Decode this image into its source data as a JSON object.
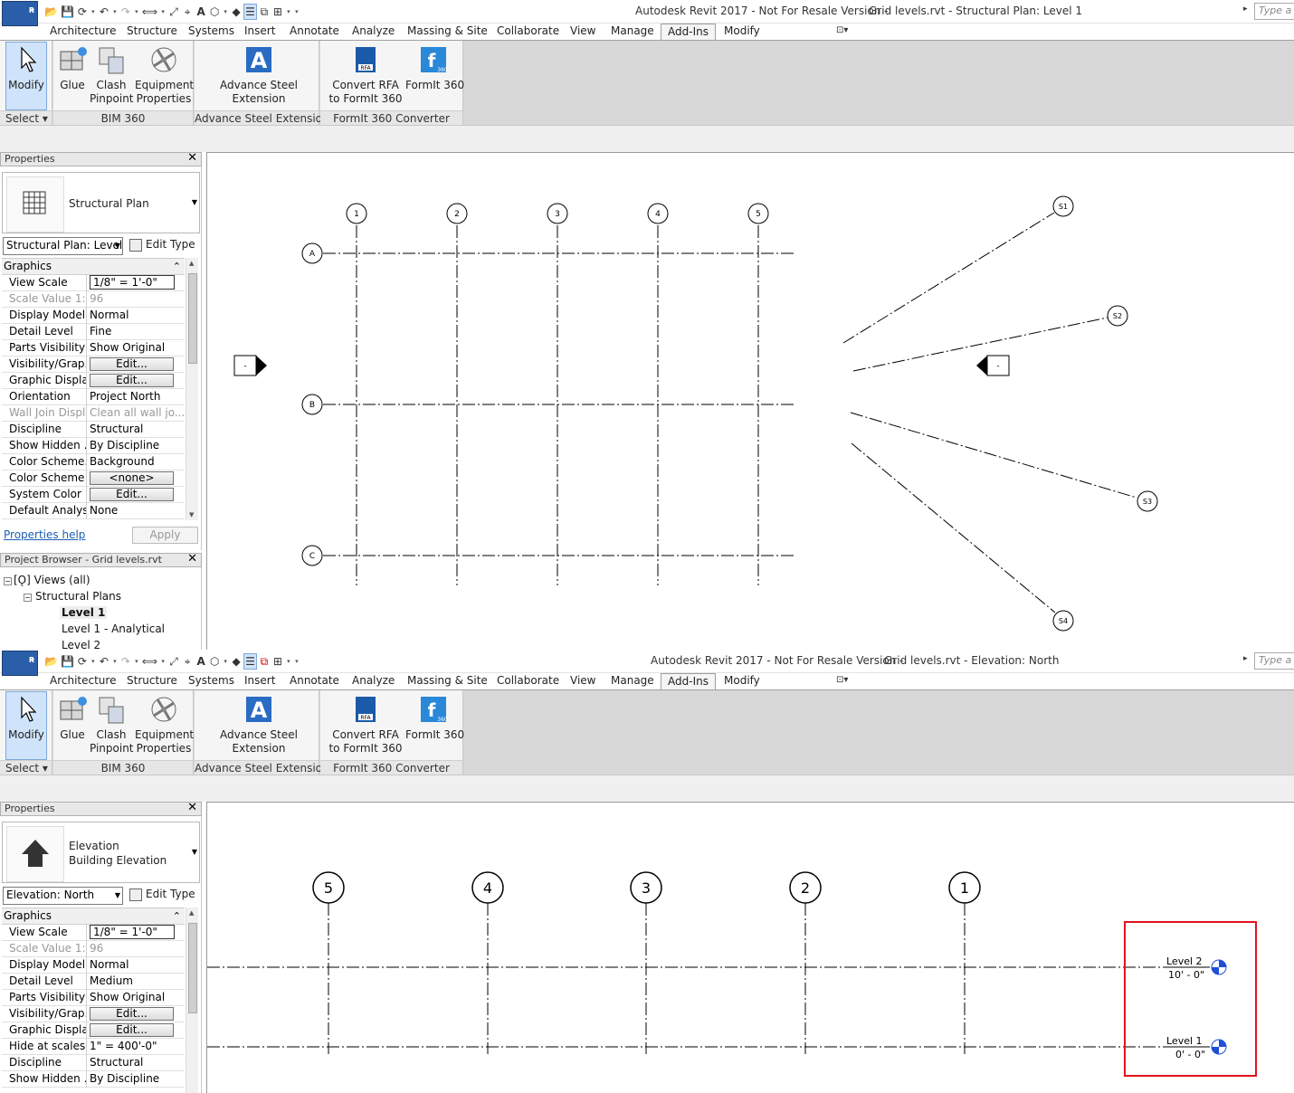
{
  "app": {
    "logo_letter": "R",
    "type_keyword_placeholder": "Type a k",
    "tabs": [
      "Architecture",
      "Structure",
      "Systems",
      "Insert",
      "Annotate",
      "Analyze",
      "Massing & Site",
      "Collaborate",
      "View",
      "Manage",
      "Add-Ins",
      "Modify"
    ],
    "active_tab": "Add-Ins",
    "ribbon": {
      "modify": "Modify",
      "select": "Select",
      "glue": "Glue",
      "clash": [
        "Clash",
        "Pinpoint"
      ],
      "equipment": [
        "Equipment",
        "Properties"
      ],
      "bim360": "BIM 360",
      "advance_steel": [
        "Advance Steel",
        "Extension"
      ],
      "advance_steel_panel": "Advance Steel Extension",
      "convert_rfa": [
        "Convert RFA",
        "to FormIt 360"
      ],
      "formit360": "FormIt 360",
      "formit_panel": "FormIt 360 Converter",
      "rfa_badge": "RFA",
      "f360_badge": "360"
    }
  },
  "top": {
    "title_left": "Autodesk Revit 2017 - Not For Resale Version -",
    "title_right": "Grid levels.rvt - Structural Plan: Level 1",
    "properties": {
      "header": "Properties",
      "type_line1": "Structural Plan",
      "type_line2": "",
      "view_selector": "Structural Plan: Level",
      "edit_type": "Edit Type",
      "section": "Graphics",
      "rows": [
        {
          "k": "View Scale",
          "v": "1/8\" = 1'-0\"",
          "style": "input"
        },
        {
          "k": "Scale Value    1:",
          "v": "96",
          "style": "disabled"
        },
        {
          "k": "Display Model",
          "v": "Normal"
        },
        {
          "k": "Detail Level",
          "v": "Fine"
        },
        {
          "k": "Parts Visibility",
          "v": "Show Original"
        },
        {
          "k": "Visibility/Grap...",
          "v": "Edit...",
          "style": "button"
        },
        {
          "k": "Graphic Displa...",
          "v": "Edit...",
          "style": "button"
        },
        {
          "k": "Orientation",
          "v": "Project North"
        },
        {
          "k": "Wall Join Displ...",
          "v": "Clean all wall jo...",
          "style": "disabled"
        },
        {
          "k": "Discipline",
          "v": "Structural"
        },
        {
          "k": "Show Hidden ...",
          "v": "By Discipline"
        },
        {
          "k": "Color Scheme...",
          "v": "Background"
        },
        {
          "k": "Color Scheme",
          "v": "<none>",
          "style": "button"
        },
        {
          "k": "System Color ...",
          "v": "Edit...",
          "style": "button"
        },
        {
          "k": "Default Analys...",
          "v": "None"
        }
      ],
      "help": "Properties help",
      "apply": "Apply"
    },
    "browser": {
      "header": "Project Browser - Grid levels.rvt",
      "items": [
        {
          "label": "Views (all)",
          "expander": "−"
        },
        {
          "label": "Structural Plans",
          "expander": "−"
        },
        {
          "label": "Level 1",
          "bold": true
        },
        {
          "label": "Level 1 - Analytical"
        },
        {
          "label": "Level 2"
        }
      ]
    },
    "plan": {
      "vertical_grids": [
        "1",
        "2",
        "3",
        "4",
        "5"
      ],
      "horizontal_grids": [
        "A",
        "B",
        "C"
      ],
      "radial_grids": [
        "S1",
        "S2",
        "S3",
        "S4"
      ],
      "elevation_marker_text": "-"
    }
  },
  "bottom": {
    "title_left": "Autodesk Revit 2017 - Not For Resale Version -",
    "title_right": "Grid levels.rvt - Elevation: North",
    "properties": {
      "header": "Properties",
      "type_line1": "Elevation",
      "type_line2": "Building Elevation",
      "view_selector": "Elevation: North",
      "edit_type": "Edit Type",
      "section": "Graphics",
      "rows": [
        {
          "k": "View Scale",
          "v": "1/8\" = 1'-0\"",
          "style": "input"
        },
        {
          "k": "Scale Value    1:",
          "v": "96",
          "style": "disabled"
        },
        {
          "k": "Display Model",
          "v": "Normal"
        },
        {
          "k": "Detail Level",
          "v": "Medium"
        },
        {
          "k": "Parts Visibility",
          "v": "Show Original"
        },
        {
          "k": "Visibility/Grap...",
          "v": "Edit...",
          "style": "button"
        },
        {
          "k": "Graphic Displa...",
          "v": "Edit...",
          "style": "button"
        },
        {
          "k": "Hide at scales ...",
          "v": "1\" = 400'-0\""
        },
        {
          "k": "Discipline",
          "v": "Structural"
        },
        {
          "k": "Show Hidden ...",
          "v": "By Discipline"
        }
      ]
    },
    "elevation": {
      "grids": [
        "5",
        "4",
        "3",
        "2",
        "1"
      ],
      "levels": [
        {
          "name": "Level 2",
          "elev": "10' - 0\""
        },
        {
          "name": "Level 1",
          "elev": "0' - 0\""
        }
      ],
      "highlight_color": "#e0141c"
    }
  },
  "colors": {
    "accent": "#2b5ea8",
    "ribbon_bg": "#f5f5f5",
    "link": "#1a5fb4",
    "level_head_blue": "#1f4fd8"
  }
}
